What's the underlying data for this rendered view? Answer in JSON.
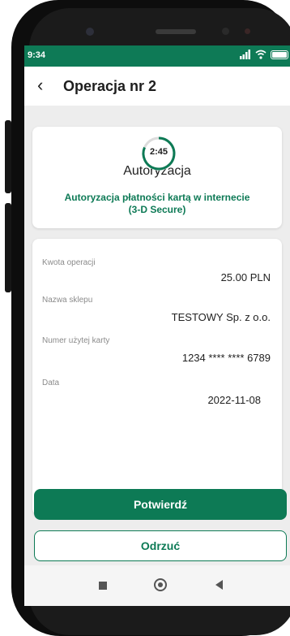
{
  "status_bar": {
    "time": "9:34"
  },
  "header": {
    "back_icon": "chevron-left-icon",
    "title": "Operacja nr 2"
  },
  "timer": {
    "remaining": "2:45"
  },
  "authorization": {
    "title": "Autoryzacja",
    "subtitle_line1": "Autoryzacja płatności kartą w internecie",
    "subtitle_line2": "(3-D Secure)"
  },
  "details": [
    {
      "label": "Kwota operacji",
      "value": "25.00 PLN"
    },
    {
      "label": "Nazwa sklepu",
      "value": "TESTOWY Sp. z o.o."
    },
    {
      "label": "Numer użytej karty",
      "value": "1234 **** **** 6789"
    },
    {
      "label": "Data",
      "value": "2022-11-08"
    }
  ],
  "actions": {
    "confirm": "Potwierdź",
    "reject": "Odrzuć"
  },
  "colors": {
    "brand_green": "#0d7a55",
    "screen_bg": "#ededed"
  }
}
